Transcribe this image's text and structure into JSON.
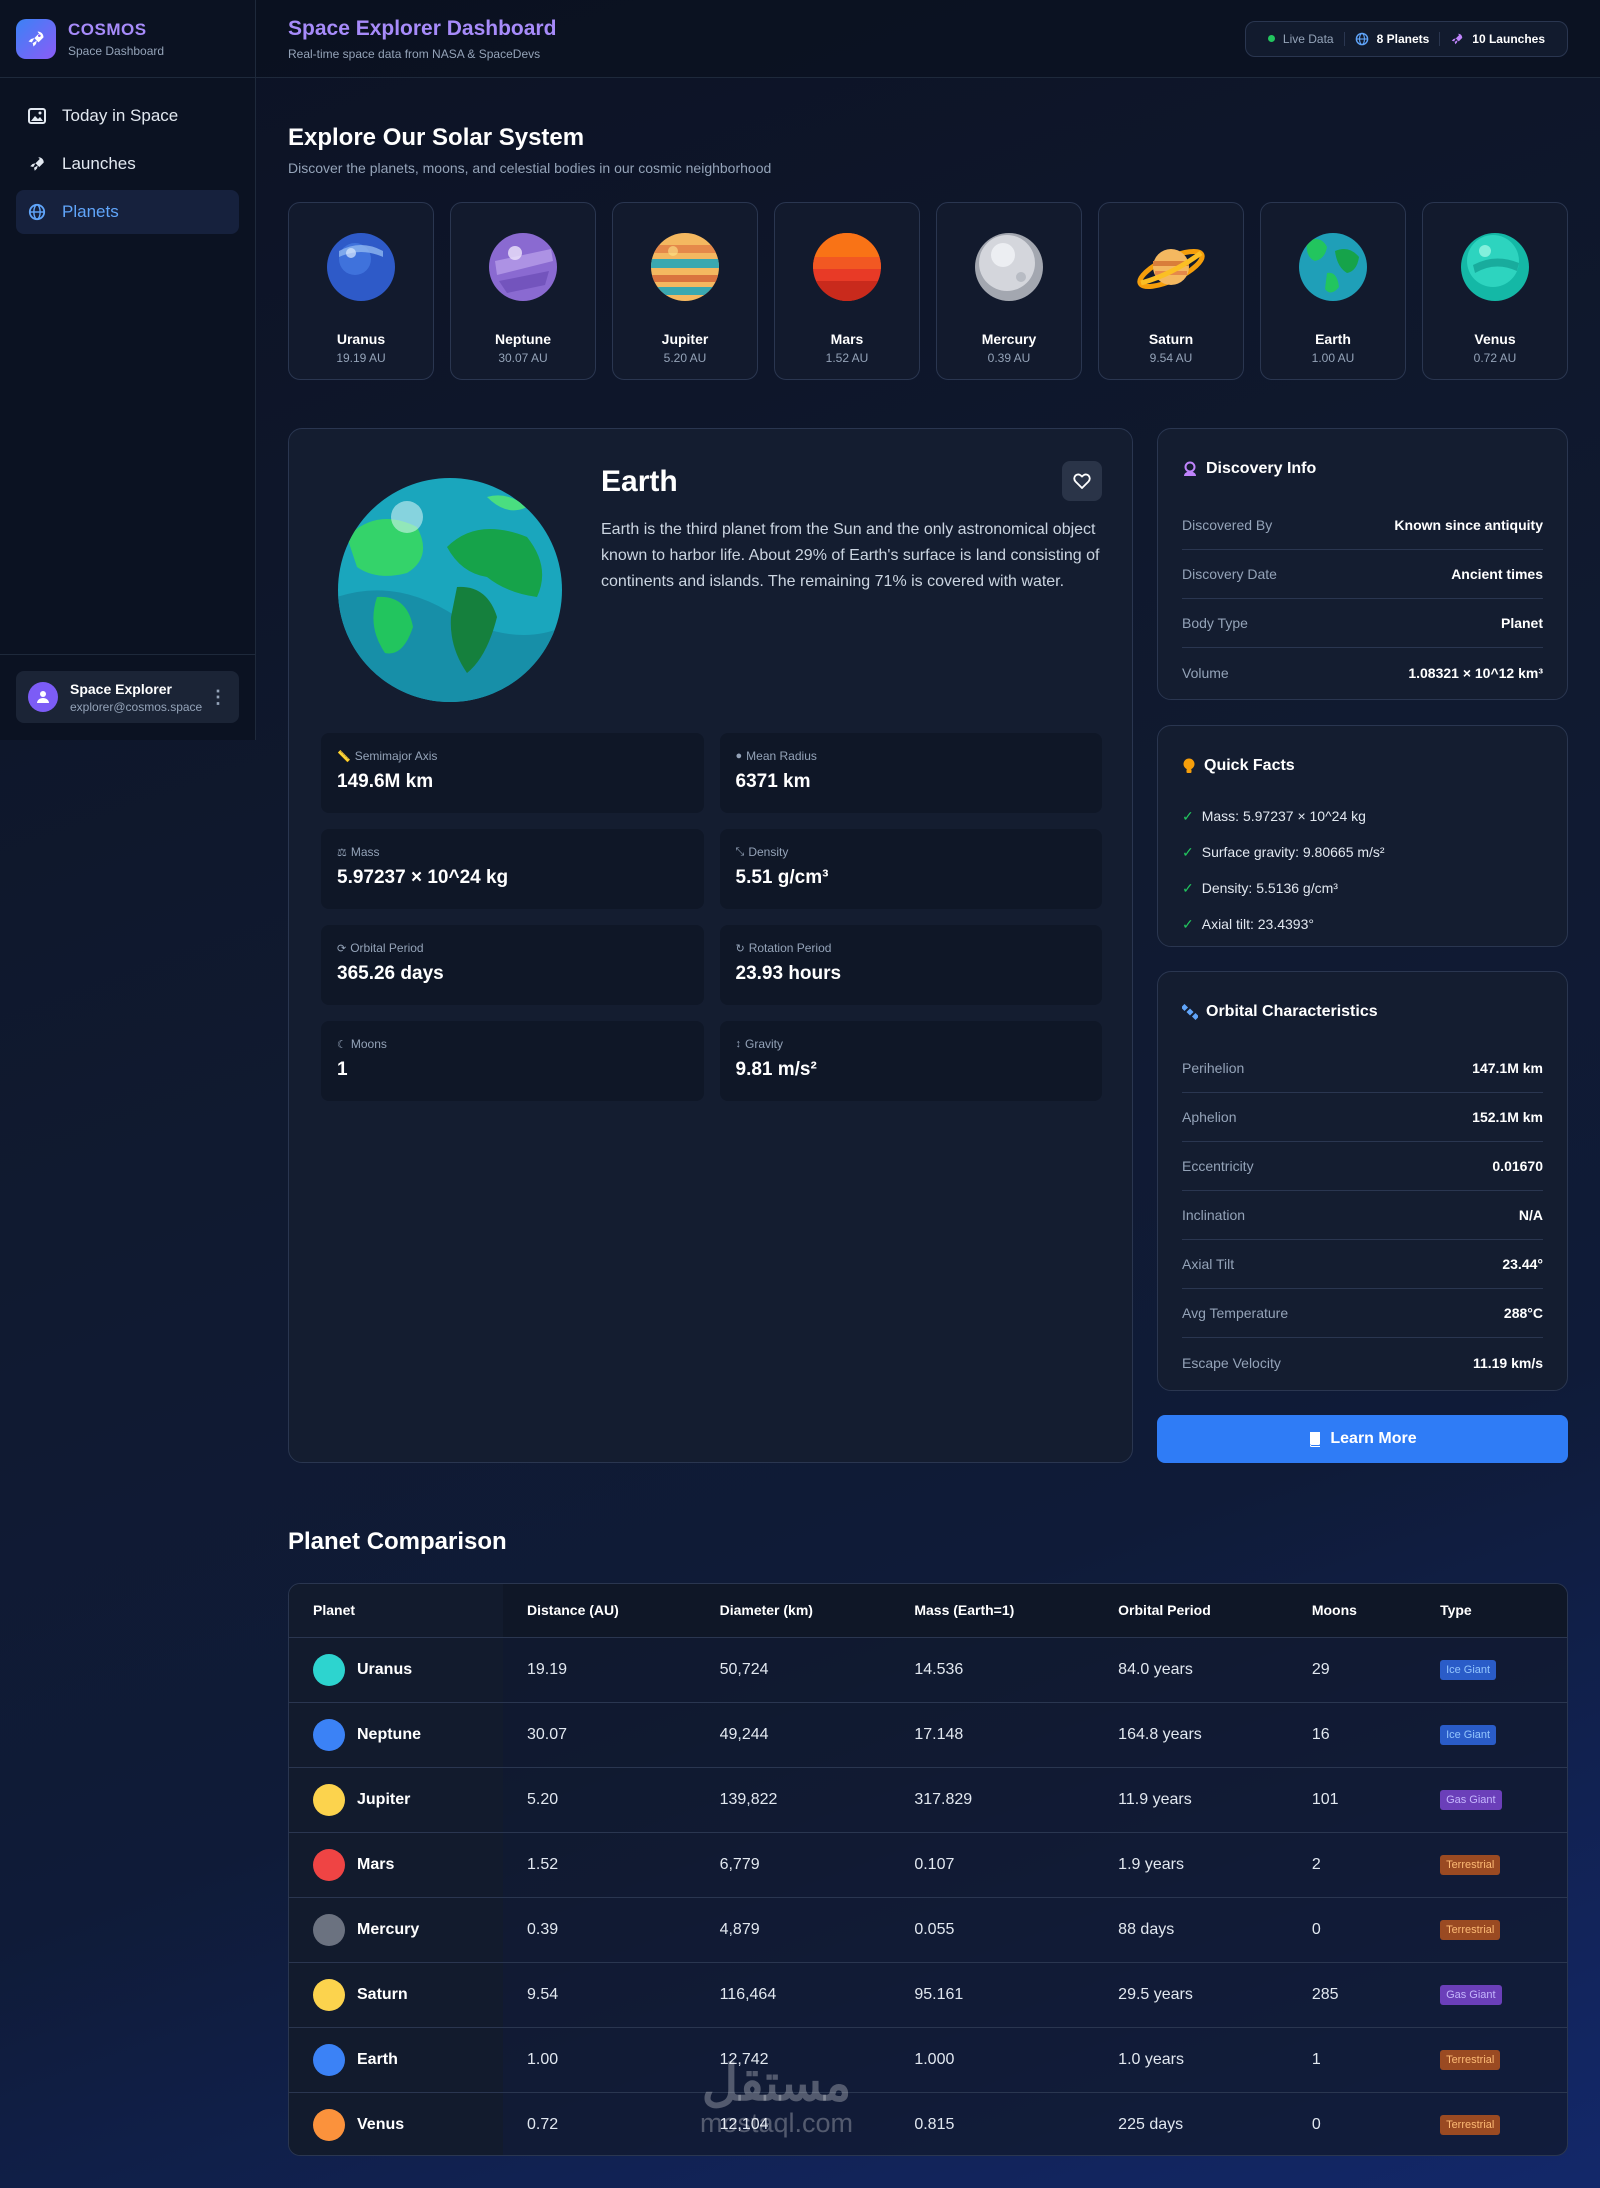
{
  "brand": {
    "name": "COSMOS",
    "subtitle": "Space Dashboard"
  },
  "nav": [
    {
      "label": "Today in Space",
      "icon": "image-icon"
    },
    {
      "label": "Launches",
      "icon": "rocket-icon"
    },
    {
      "label": "Planets",
      "icon": "globe-icon",
      "active": true
    }
  ],
  "user": {
    "name": "Space Explorer",
    "email": "explorer@cosmos.space"
  },
  "header": {
    "title": "Space Explorer Dashboard",
    "subtitle": "Real-time space data from NASA & SpaceDevs",
    "live": "Live Data",
    "planets_count": "8 Planets",
    "launches_count": "10 Launches"
  },
  "explore": {
    "title": "Explore Our Solar System",
    "subtitle": "Discover the planets, moons, and celestial bodies in our cosmic neighborhood",
    "planets": [
      {
        "name": "Uranus",
        "dist": "19.19 AU"
      },
      {
        "name": "Neptune",
        "dist": "30.07 AU"
      },
      {
        "name": "Jupiter",
        "dist": "5.20 AU"
      },
      {
        "name": "Mars",
        "dist": "1.52 AU"
      },
      {
        "name": "Mercury",
        "dist": "0.39 AU"
      },
      {
        "name": "Saturn",
        "dist": "9.54 AU"
      },
      {
        "name": "Earth",
        "dist": "1.00 AU"
      },
      {
        "name": "Venus",
        "dist": "0.72 AU"
      }
    ]
  },
  "detail": {
    "name": "Earth",
    "description": "Earth is the third planet from the Sun and the only astronomical object known to harbor life. About 29% of Earth's surface is land consisting of continents and islands. The remaining 71% is covered with water.",
    "stats": [
      {
        "label": "Semimajor Axis",
        "value": "149.6M km",
        "icon": "ruler-icon"
      },
      {
        "label": "Mean Radius",
        "value": "6371 km",
        "icon": "circle-icon"
      },
      {
        "label": "Mass",
        "value": "5.97237 × 10^24 kg",
        "icon": "weight-icon"
      },
      {
        "label": "Density",
        "value": "5.51 g/cm³",
        "icon": "compress-icon"
      },
      {
        "label": "Orbital Period",
        "value": "365.26 days",
        "icon": "sync-icon"
      },
      {
        "label": "Rotation Period",
        "value": "23.93 hours",
        "icon": "redo-icon"
      },
      {
        "label": "Moons",
        "value": "1",
        "icon": "moon-icon"
      },
      {
        "label": "Gravity",
        "value": "9.81 m/s²",
        "icon": "arrows-vertical-icon"
      }
    ]
  },
  "discovery": {
    "title": "Discovery Info",
    "rows": [
      {
        "k": "Discovered By",
        "v": "Known since antiquity"
      },
      {
        "k": "Discovery Date",
        "v": "Ancient times"
      },
      {
        "k": "Body Type",
        "v": "Planet"
      },
      {
        "k": "Volume",
        "v": "1.08321 × 10^12 km³"
      }
    ]
  },
  "facts": {
    "title": "Quick Facts",
    "items": [
      "Mass: 5.97237 × 10^24 kg",
      "Surface gravity: 9.80665 m/s²",
      "Density: 5.5136 g/cm³",
      "Axial tilt: 23.4393°"
    ]
  },
  "orbital": {
    "title": "Orbital Characteristics",
    "rows": [
      {
        "k": "Perihelion",
        "v": "147.1M km"
      },
      {
        "k": "Aphelion",
        "v": "152.1M km"
      },
      {
        "k": "Eccentricity",
        "v": "0.01670"
      },
      {
        "k": "Inclination",
        "v": "N/A"
      },
      {
        "k": "Axial Tilt",
        "v": "23.44°"
      },
      {
        "k": "Avg Temperature",
        "v": "288°C"
      },
      {
        "k": "Escape Velocity",
        "v": "11.19 km/s"
      }
    ]
  },
  "learn_more": "Learn More",
  "comparison": {
    "title": "Planet Comparison",
    "headers": [
      "Planet",
      "Distance (AU)",
      "Diameter (km)",
      "Mass (Earth=1)",
      "Orbital Period",
      "Moons",
      "Type"
    ],
    "rows": [
      {
        "planet": "Uranus",
        "color": "#2dd4cf",
        "dist": "19.19",
        "diam": "50,724",
        "mass": "14.536",
        "period": "84.0 years",
        "moons": "29",
        "type": "Ice Giant",
        "tclass": "b-ice"
      },
      {
        "planet": "Neptune",
        "color": "#3b82f6",
        "dist": "30.07",
        "diam": "49,244",
        "mass": "17.148",
        "period": "164.8 years",
        "moons": "16",
        "type": "Ice Giant",
        "tclass": "b-ice"
      },
      {
        "planet": "Jupiter",
        "color": "#fcd34d",
        "dist": "5.20",
        "diam": "139,822",
        "mass": "317.829",
        "period": "11.9 years",
        "moons": "101",
        "type": "Gas Giant",
        "tclass": "b-gas"
      },
      {
        "planet": "Mars",
        "color": "#ef4444",
        "dist": "1.52",
        "diam": "6,779",
        "mass": "0.107",
        "period": "1.9 years",
        "moons": "2",
        "type": "Terrestrial",
        "tclass": "b-ter"
      },
      {
        "planet": "Mercury",
        "color": "#6b7280",
        "dist": "0.39",
        "diam": "4,879",
        "mass": "0.055",
        "period": "88 days",
        "moons": "0",
        "type": "Terrestrial",
        "tclass": "b-ter"
      },
      {
        "planet": "Saturn",
        "color": "#fcd34d",
        "dist": "9.54",
        "diam": "116,464",
        "mass": "95.161",
        "period": "29.5 years",
        "moons": "285",
        "type": "Gas Giant",
        "tclass": "b-gas"
      },
      {
        "planet": "Earth",
        "color": "#3b82f6",
        "dist": "1.00",
        "diam": "12,742",
        "mass": "1.000",
        "period": "1.0 years",
        "moons": "1",
        "type": "Terrestrial",
        "tclass": "b-ter"
      },
      {
        "planet": "Venus",
        "color": "#fb923c",
        "dist": "0.72",
        "diam": "12,104",
        "mass": "0.815",
        "period": "225 days",
        "moons": "0",
        "type": "Terrestrial",
        "tclass": "b-ter"
      }
    ]
  },
  "watermark": {
    "arabic": "مستقل",
    "latin": "mostaql.com"
  }
}
